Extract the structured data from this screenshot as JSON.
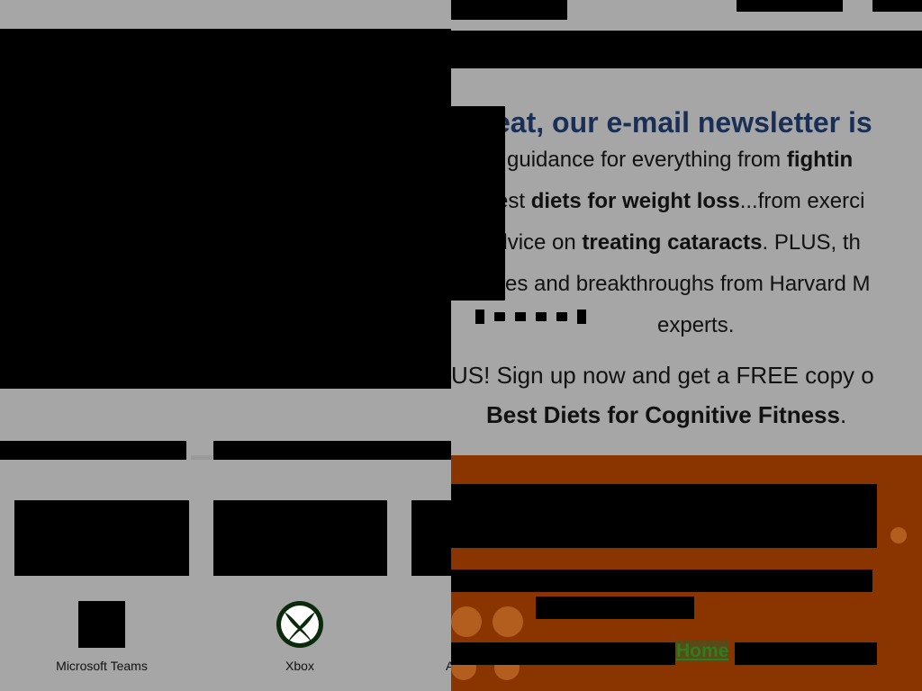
{
  "left_pane": {
    "apps": [
      {
        "name": "Microsoft Teams",
        "icon": "teams-icon"
      },
      {
        "name": "Xbox",
        "icon": "xbox-icon"
      },
      {
        "name": "A",
        "icon": "app-icon"
      }
    ]
  },
  "newsletter": {
    "title": "eat, our e-mail newsletter is",
    "line1_pre": "d guidance for everything from ",
    "line1_bold": "fightin",
    "line2_pre": "est ",
    "line2_bold": "diets for weight loss",
    "line2_post": "...from exerci",
    "line3_pre": "advice on ",
    "line3_bold": "treating cataracts",
    "line3_post": ". PLUS, th",
    "line4": "es and breakthroughs from Harvard M",
    "line5": "experts.",
    "line6": "US! Sign up now and get a FREE copy o",
    "line7_bold": "Best Diets for Cognitive Fitness",
    "line7_post": "."
  },
  "promo": {
    "home_link": "Home"
  },
  "colors": {
    "dim_background": "#a6a6a6",
    "headline": "#1a2f55",
    "promo_background": "#8a3500",
    "link": "#2e7d1e"
  }
}
